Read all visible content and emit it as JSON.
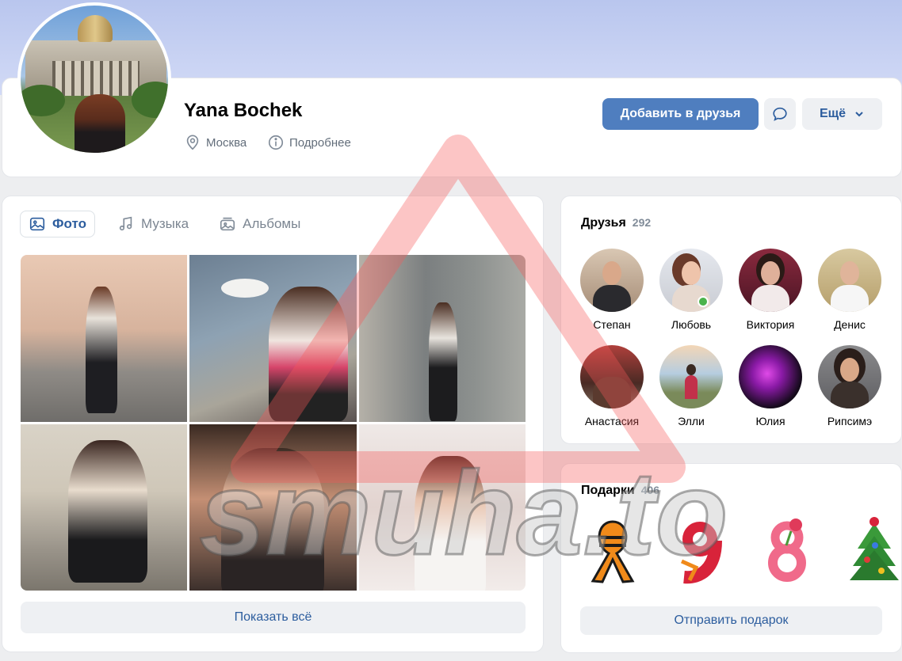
{
  "profile": {
    "name": "Yana Bochek",
    "city": "Москва",
    "details_label": "Подробнее",
    "add_friend_label": "Добавить в друзья",
    "more_label": "Ещё"
  },
  "photos": {
    "tabs": [
      {
        "label": "Фото",
        "icon": "image-icon",
        "active": true
      },
      {
        "label": "Музыка",
        "icon": "music-note-icon",
        "active": false
      },
      {
        "label": "Альбомы",
        "icon": "albums-icon",
        "active": false
      }
    ],
    "show_all_label": "Показать всё"
  },
  "friends": {
    "title": "Друзья",
    "count": "292",
    "items": [
      {
        "name": "Степан"
      },
      {
        "name": "Любовь",
        "online": true
      },
      {
        "name": "Виктория"
      },
      {
        "name": "Денис"
      },
      {
        "name": "Анастасия"
      },
      {
        "name": "Элли"
      },
      {
        "name": "Юлия"
      },
      {
        "name": "Рипсимэ"
      }
    ]
  },
  "gifts": {
    "title": "Подарки",
    "count": "406",
    "items": [
      "ribbon-gift-icon",
      "number-9-gift-icon",
      "number-8-gift-icon",
      "christmas-tree-gift-icon"
    ],
    "send_label": "Отправить подарок"
  },
  "watermark": {
    "text": "smuha.to"
  },
  "colors": {
    "accent": "#4f7ebf",
    "link": "#2c5d9e",
    "online": "#4bb34b"
  }
}
